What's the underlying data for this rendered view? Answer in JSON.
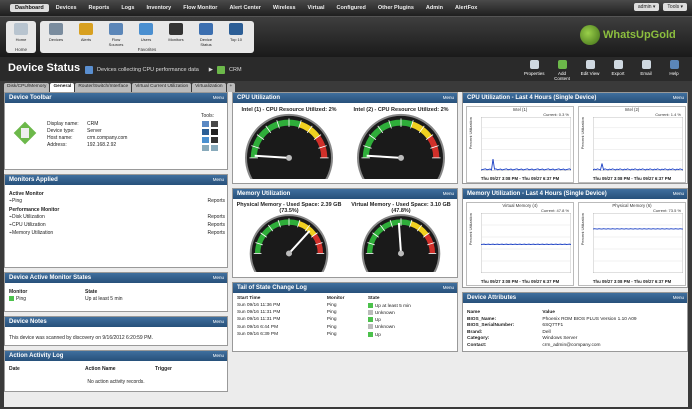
{
  "topnav": {
    "items": [
      "Dashboard",
      "Devices",
      "Reports",
      "Logs",
      "Inventory",
      "Flow Monitor",
      "Alert Center",
      "Wireless",
      "Virtual",
      "Configured",
      "Other Plugins",
      "Admin",
      "AlertFox"
    ],
    "user": "admin ▾",
    "tools": "Tools ▾"
  },
  "toolbar": {
    "home": {
      "label": "Home",
      "group": "Home"
    },
    "favorites": {
      "group": "Favorites",
      "buttons": [
        "Devices",
        "Alerts",
        "Flow Sources",
        "Users",
        "Monitors",
        "Device Status",
        "Top 10"
      ]
    }
  },
  "logo": {
    "text": "WhatsUpGold"
  },
  "title": {
    "page": "Device Status",
    "group": "Devices collecting CPU performance data",
    "device": "CRM"
  },
  "title_actions": [
    "Properties",
    "Add Content",
    "Edit View",
    "Export",
    "Email",
    "Help"
  ],
  "tabs": [
    "Disk/CPU/Memory",
    "General",
    "Router/Switch/Interface",
    "Virtual Current Utilization",
    "Virtualization",
    "+"
  ],
  "menu": "Menu",
  "device_toolbar": {
    "title": "Device Toolbar",
    "tools_label": "Tools:",
    "rows": [
      {
        "k": "Display name:",
        "v": "CRM"
      },
      {
        "k": "Device type:",
        "v": "Server"
      },
      {
        "k": "Host name:",
        "v": "crm.company.com"
      },
      {
        "k": "Address:",
        "v": "192.168.2.92"
      }
    ]
  },
  "monitors_applied": {
    "title": "Monitors Applied",
    "active_label": "Active Monitor",
    "perf_label": "Performance Monitor",
    "reports": "Reports",
    "active": [
      "Ping"
    ],
    "performance": [
      "Disk Utilization",
      "CPU Utilization",
      "Memory Utilization"
    ]
  },
  "device_active_monitor": {
    "title": "Device Active Monitor States",
    "col1": "Monitor",
    "col2": "State",
    "monitor": "Ping",
    "state": "Up at least 5 min"
  },
  "device_notes": {
    "title": "Device Notes",
    "text": "This device was scanned by discovery on 9/16/2012 6:20:59 PM."
  },
  "action_log": {
    "title": "Action Activity Log",
    "cols": [
      "Date",
      "Action Name",
      "Trigger"
    ],
    "empty": "No action activity records."
  },
  "cpu_util": {
    "title": "CPU Utilization",
    "g1": "Intel (1) - CPU Resource Utilized: 2%",
    "g2": "Intel (2) - CPU Resource Utilized: 2%",
    "v1": 2,
    "v2": 2
  },
  "mem_util": {
    "title": "Memory Utilization",
    "g1": "Physical Memory - Used Space: 2.39 GB (73.5%)",
    "g2": "Virtual Memory - Used Space: 3.10 GB (47.8%)",
    "v1": 73.5,
    "v2": 47.8
  },
  "tail": {
    "title": "Tail of State Change Log",
    "cols": [
      "Start Time",
      "Monitor",
      "State"
    ],
    "rows": [
      {
        "t": "Sun 09/16 11:36 PM",
        "m": "Ping",
        "s": "Up at least 5 min",
        "c": "green"
      },
      {
        "t": "Sun 09/16 11:31 PM",
        "m": "Ping",
        "s": "Unknown",
        "c": "gray"
      },
      {
        "t": "Sun 09/16 11:31 PM",
        "m": "Ping",
        "s": "Up",
        "c": "green"
      },
      {
        "t": "Sun 09/16 6:44 PM",
        "m": "Ping",
        "s": "Unknown",
        "c": "gray"
      },
      {
        "t": "Sun 09/16 6:39 PM",
        "m": "Ping",
        "s": "Up",
        "c": "green"
      }
    ]
  },
  "cpu4h": {
    "title": "CPU Utilization - Last 4 Hours (Single Device)",
    "c1": "Intel (1)",
    "c2": "Intel (2)",
    "cur1": "Current: 0.3 %",
    "cur2": "Current: 1.4 %",
    "range": "Thu 09/27 3:08 PM - Thu 09/27 6:37 PM",
    "ylab": "Percent Utilization",
    "yticks": [
      "100",
      "80",
      "60",
      "40",
      "20",
      "0"
    ]
  },
  "mem4h": {
    "title": "Memory Utilization - Last 4 Hours (Single Device)",
    "c1": "Virtual Memory (4)",
    "c2": "Physical Memory (6)",
    "cur1": "Current: 47.8 %",
    "cur2": "Current: 73.5 %",
    "range": "Thu 09/27 3:08 PM - Thu 09/27 6:37 PM",
    "ylab": "Percent Utilization",
    "v1": 47.8,
    "v2": 73.5
  },
  "attributes": {
    "title": "Device Attributes",
    "cols": [
      "Name",
      "Value"
    ],
    "rows": [
      {
        "k": "BIOS_Name:",
        "v": "Phoenix ROM BIOS PLUS Version 1.10 A09"
      },
      {
        "k": "BIOS_SerialNumber:",
        "v": "6SQ7TF1"
      },
      {
        "k": "Brand:",
        "v": "Dell"
      },
      {
        "k": "Category:",
        "v": "Windows Server"
      },
      {
        "k": "Contact:",
        "v": "crm_admin@company.com"
      }
    ]
  }
}
